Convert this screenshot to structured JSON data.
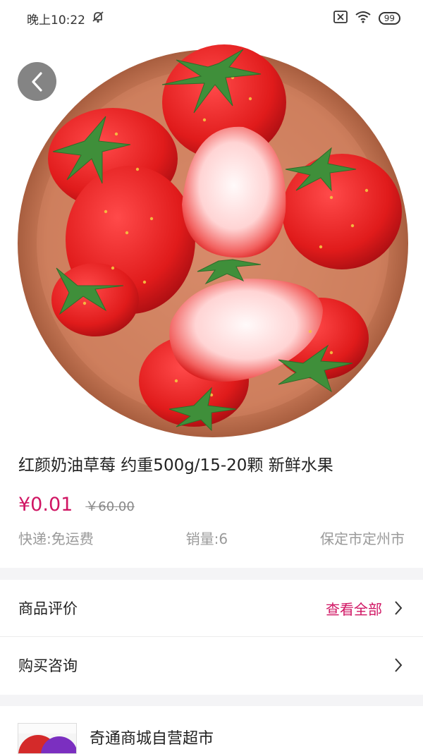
{
  "status_bar": {
    "time": "晚上10:22",
    "battery": "99",
    "icons": [
      "mute-icon",
      "sim-off-icon",
      "wifi-icon",
      "battery-icon"
    ]
  },
  "product": {
    "title": "红颜奶油草莓 约重500g/15-20颗 新鲜水果",
    "price": "¥0.01",
    "original_price": "￥60.00",
    "shipping": "快递:免运费",
    "sales": "销量:6",
    "location": "保定市定州市"
  },
  "reviews": {
    "label": "商品评价",
    "view_all": "查看全部"
  },
  "consult": {
    "label": "购买咨询"
  },
  "store": {
    "name": "奇通商城自营超市"
  },
  "colors": {
    "accent": "#d01563",
    "muted": "#9a9a9a",
    "band": "#f4f4f6"
  }
}
